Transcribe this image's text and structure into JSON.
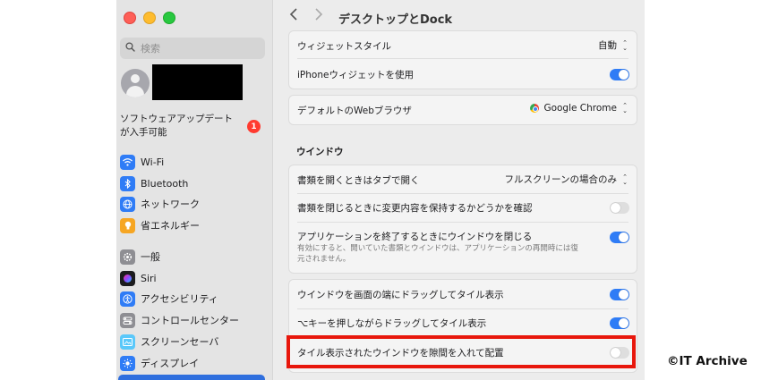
{
  "window": {
    "title": "デスクトップとDock"
  },
  "sidebar": {
    "search_placeholder": "検索",
    "update": {
      "label": "ソフトウェアアップデートが入手可能",
      "badge": "1"
    },
    "items": [
      {
        "label": "Wi-Fi",
        "icon": "wifi-icon",
        "color": "#2f7cf6"
      },
      {
        "label": "Bluetooth",
        "icon": "bluetooth-icon",
        "color": "#2f7cf6"
      },
      {
        "label": "ネットワーク",
        "icon": "globe-icon",
        "color": "#2f7cf6"
      },
      {
        "label": "省エネルギー",
        "icon": "lightbulb-icon",
        "color": "#f6a623"
      },
      {
        "label": "一般",
        "icon": "gear-icon",
        "color": "#8e8e93"
      },
      {
        "label": "Siri",
        "icon": "siri-icon",
        "color": "#1c1c1e"
      },
      {
        "label": "アクセシビリティ",
        "icon": "accessibility-icon",
        "color": "#2f7cf6"
      },
      {
        "label": "コントロールセンター",
        "icon": "control-center-icon",
        "color": "#8e8e93"
      },
      {
        "label": "スクリーンセーバ",
        "icon": "screensaver-icon",
        "color": "#5ac8fa"
      },
      {
        "label": "ディスプレイ",
        "icon": "display-icon",
        "color": "#2f7cf6"
      }
    ]
  },
  "settings": {
    "widget_style": {
      "label": "ウィジェットスタイル",
      "value": "自動"
    },
    "iphone_widgets": {
      "label": "iPhoneウィジェットを使用",
      "on": true
    },
    "default_browser": {
      "label": "デフォルトのWebブラウザ",
      "value": "Google Chrome"
    },
    "window_section": "ウインドウ",
    "prefer_tabs": {
      "label": "書類を開くときはタブで開く",
      "value": "フルスクリーンの場合のみ"
    },
    "ask_keep_changes": {
      "label": "書類を閉じるときに変更内容を保持するかどうかを確認",
      "on": false
    },
    "close_windows": {
      "label": "アプリケーションを終了するときにウインドウを閉じる",
      "desc": "有効にすると、開いていた書類とウインドウは、アプリケーションの再開時には復元されません。",
      "on": true
    },
    "tile_drag_edge": {
      "label": "ウインドウを画面の端にドラッグしてタイル表示",
      "on": true
    },
    "tile_option_drag": {
      "label": "⌥キーを押しながらドラッグしてタイル表示",
      "on": true
    },
    "tile_margins": {
      "label": "タイル表示されたウインドウを隙間を入れて配置",
      "on": false
    }
  },
  "watermark": "©IT Archive"
}
